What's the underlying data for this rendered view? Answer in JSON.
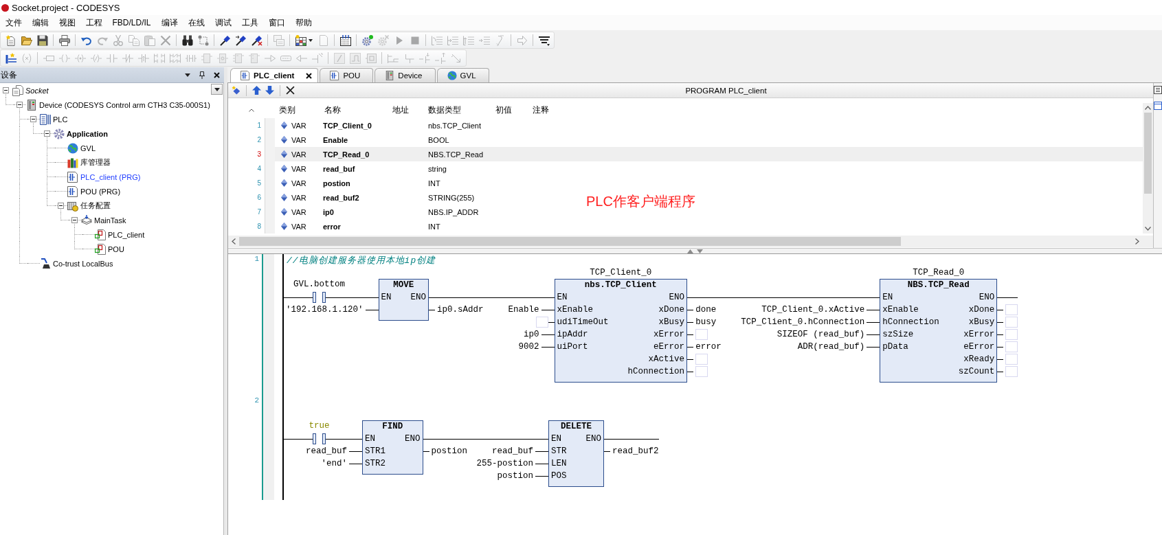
{
  "window": {
    "title": "Socket.project - CODESYS"
  },
  "menu": [
    "文件",
    "编辑",
    "视图",
    "工程",
    "FBD/LD/IL",
    "编译",
    "在线",
    "调试",
    "工具",
    "窗口",
    "帮助"
  ],
  "toolbars": [
    {
      "groups": [
        [
          {
            "kind": "new",
            "disabled": false
          },
          {
            "kind": "open",
            "disabled": false
          },
          {
            "kind": "save",
            "disabled": false
          }
        ],
        [
          {
            "kind": "print",
            "disabled": false
          }
        ],
        [
          {
            "kind": "undo",
            "disabled": false
          },
          {
            "kind": "redo",
            "disabled": true
          },
          {
            "kind": "cut",
            "disabled": true
          },
          {
            "kind": "copy",
            "disabled": true
          },
          {
            "kind": "paste",
            "disabled": true
          },
          {
            "kind": "delete",
            "disabled": true
          }
        ],
        [
          {
            "kind": "find",
            "disabled": false
          },
          {
            "kind": "replace",
            "disabled": false
          }
        ],
        [
          {
            "kind": "marker",
            "disabled": false
          },
          {
            "kind": "marker-next",
            "disabled": false
          },
          {
            "kind": "marker-clear",
            "disabled": false
          }
        ],
        [
          {
            "kind": "windows",
            "disabled": true
          }
        ],
        [
          {
            "kind": "table",
            "disabled": false,
            "menu": true
          },
          {
            "kind": "document",
            "disabled": true
          }
        ],
        [
          {
            "kind": "build",
            "disabled": false
          }
        ],
        [
          {
            "kind": "login",
            "disabled": false
          },
          {
            "kind": "logout",
            "disabled": true
          },
          {
            "kind": "play",
            "disabled": true
          },
          {
            "kind": "stop",
            "disabled": true
          }
        ],
        [
          {
            "kind": "step-over",
            "disabled": true
          },
          {
            "kind": "step-into",
            "disabled": true
          },
          {
            "kind": "step-out",
            "disabled": true
          },
          {
            "kind": "step-cursor",
            "disabled": true
          },
          {
            "kind": "step-next",
            "disabled": true
          }
        ],
        [
          {
            "kind": "forward",
            "disabled": true
          }
        ],
        [
          {
            "kind": "options",
            "disabled": false
          }
        ]
      ]
    },
    {
      "groups": [
        [
          {
            "kind": "network",
            "disabled": false
          },
          {
            "kind": "parens",
            "disabled": true
          }
        ],
        [
          {
            "kind": "variable",
            "disabled": true
          },
          {
            "kind": "coil",
            "disabled": true
          },
          {
            "kind": "coil-set",
            "disabled": true
          },
          {
            "kind": "coil-reset",
            "disabled": true
          },
          {
            "kind": "contact",
            "disabled": true
          },
          {
            "kind": "contact-neg",
            "disabled": true
          },
          {
            "kind": "contact-edge",
            "disabled": true
          },
          {
            "kind": "contacts-parallel",
            "disabled": true
          },
          {
            "kind": "contacts-neg-parallel",
            "disabled": true
          },
          {
            "kind": "contacts-series",
            "disabled": true
          },
          {
            "kind": "block",
            "disabled": true
          },
          {
            "kind": "block-ring",
            "disabled": true
          },
          {
            "kind": "block-pins",
            "disabled": true
          },
          {
            "kind": "block-stub",
            "disabled": true
          },
          {
            "kind": "jump",
            "disabled": true
          },
          {
            "kind": "label",
            "disabled": true
          },
          {
            "kind": "return",
            "disabled": true
          },
          {
            "kind": "branch-start",
            "disabled": true
          }
        ],
        [
          {
            "kind": "negate",
            "disabled": true
          },
          {
            "kind": "edge",
            "disabled": true
          },
          {
            "kind": "set",
            "disabled": true
          }
        ],
        [
          {
            "kind": "branch",
            "disabled": true
          },
          {
            "kind": "branch-end",
            "disabled": true
          },
          {
            "kind": "branch-down",
            "disabled": true
          },
          {
            "kind": "branch-up",
            "disabled": true
          },
          {
            "kind": "branch-diag",
            "disabled": true
          }
        ]
      ]
    }
  ],
  "device_tree": {
    "header": "设备",
    "items": [
      {
        "label": "Socket",
        "kind": "project",
        "expanded": true,
        "active": false,
        "highlighted": false,
        "children": [
          {
            "label": "Device (CODESYS Control arm CTH3 C35-000S1)",
            "kind": "device",
            "expanded": true,
            "active": false,
            "highlighted": false,
            "children": [
              {
                "label": "PLC",
                "kind": "plc",
                "expanded": true,
                "active": false,
                "highlighted": false,
                "children": [
                  {
                    "label": "Application",
                    "kind": "application",
                    "expanded": true,
                    "active": true,
                    "highlighted": false,
                    "children": [
                      {
                        "label": "GVL",
                        "kind": "gvl",
                        "active": false,
                        "highlighted": false
                      },
                      {
                        "label": "库管理器",
                        "kind": "library",
                        "active": false,
                        "highlighted": false
                      },
                      {
                        "label": "PLC_client (PRG)",
                        "kind": "program",
                        "active": false,
                        "highlighted": true
                      },
                      {
                        "label": "POU (PRG)",
                        "kind": "program",
                        "active": false,
                        "highlighted": false
                      },
                      {
                        "label": "任务配置",
                        "kind": "tasks",
                        "expanded": true,
                        "active": false,
                        "highlighted": false,
                        "children": [
                          {
                            "label": "MainTask",
                            "kind": "task",
                            "expanded": true,
                            "active": false,
                            "highlighted": false,
                            "children": [
                              {
                                "label": "PLC_client",
                                "kind": "call",
                                "active": false,
                                "highlighted": false
                              },
                              {
                                "label": "POU",
                                "kind": "call",
                                "active": false,
                                "highlighted": false
                              }
                            ]
                          }
                        ]
                      }
                    ]
                  }
                ]
              },
              {
                "label": "Co-trust LocalBus",
                "kind": "bus",
                "active": false,
                "highlighted": false
              }
            ]
          }
        ]
      }
    ]
  },
  "tabs": [
    {
      "label": "PLC_client",
      "kind": "program",
      "selected": true
    },
    {
      "label": "POU",
      "kind": "program",
      "selected": false
    },
    {
      "label": "Device",
      "kind": "device",
      "selected": false
    },
    {
      "label": "GVL",
      "kind": "gvl",
      "selected": false
    }
  ],
  "declaration": {
    "title": "PROGRAM PLC_client",
    "columns": [
      "类别",
      "名称",
      "地址",
      "数据类型",
      "初值",
      "注释"
    ],
    "rows": [
      {
        "line": "1",
        "class": "VAR",
        "name": "TCP_Client_0",
        "type": "nbs.TCP_Client",
        "selected": false
      },
      {
        "line": "2",
        "class": "VAR",
        "name": "Enable",
        "type": "BOOL",
        "selected": false
      },
      {
        "line": "3",
        "class": "VAR",
        "name": "TCP_Read_0",
        "type": "NBS.TCP_Read",
        "selected": true
      },
      {
        "line": "4",
        "class": "VAR",
        "name": "read_buf",
        "type": "string",
        "selected": false
      },
      {
        "line": "5",
        "class": "VAR",
        "name": "postion",
        "type": "INT",
        "selected": false
      },
      {
        "line": "6",
        "class": "VAR",
        "name": "read_buf2",
        "type": "STRING(255)",
        "selected": false
      },
      {
        "line": "7",
        "class": "VAR",
        "name": "ip0",
        "type": "NBS.IP_ADDR",
        "selected": false
      },
      {
        "line": "8",
        "class": "VAR",
        "name": "error",
        "type": "INT",
        "selected": false
      }
    ]
  },
  "annotation": "PLC作客户端程序",
  "ladder": {
    "networks": [
      {
        "number": "1",
        "comment": "//电脑创建服务器使用本地ip创建",
        "contact": {
          "variable": "GVL.bottom",
          "constant": false
        },
        "blocks": [
          {
            "type": "MOVE",
            "en": "EN",
            "eno": "ENO",
            "inputs": [
              {
                "value": "'192.168.1.120'"
              }
            ],
            "outputs": [
              {
                "value": "ip0.sAddr"
              }
            ]
          },
          {
            "instance": "TCP_Client_0",
            "type": "nbs.TCP_Client",
            "en": "EN",
            "eno": "ENO",
            "inputs": [
              {
                "pin": "xEnable",
                "value": "Enable"
              },
              {
                "pin": "udiTimeOut"
              },
              {
                "pin": "ipAddr",
                "value": "ip0"
              },
              {
                "pin": "uiPort",
                "value": "9002"
              }
            ],
            "outputs": [
              {
                "pin": "xDone",
                "value": "done"
              },
              {
                "pin": "xBusy",
                "value": "busy"
              },
              {
                "pin": "xError"
              },
              {
                "pin": "eError",
                "value": "error"
              },
              {
                "pin": "xActive"
              },
              {
                "pin": "hConnection"
              }
            ]
          },
          {
            "instance": "TCP_Read_0",
            "type": "NBS.TCP_Read",
            "en": "EN",
            "eno": "ENO",
            "inputs": [
              {
                "pin": "xEnable",
                "value": "TCP_Client_0.xActive"
              },
              {
                "pin": "hConnection",
                "value": "TCP_Client_0.hConnection"
              },
              {
                "pin": "szSize",
                "value": "SIZEOF (read_buf)"
              },
              {
                "pin": "pData",
                "value": "ADR(read_buf)"
              }
            ],
            "outputs": [
              {
                "pin": "xDone"
              },
              {
                "pin": "xBusy"
              },
              {
                "pin": "xError"
              },
              {
                "pin": "eError"
              },
              {
                "pin": "xReady"
              },
              {
                "pin": "szCount"
              }
            ]
          }
        ]
      },
      {
        "number": "2",
        "contact": {
          "variable": "true",
          "constant": true
        },
        "blocks": [
          {
            "type": "FIND",
            "en": "EN",
            "eno": "ENO",
            "inputs": [
              {
                "pin": "STR1",
                "value": "read_buf"
              },
              {
                "pin": "STR2",
                "value": "'end'"
              }
            ],
            "outputs": [
              {
                "value": "postion"
              }
            ]
          },
          {
            "type": "DELETE",
            "en": "EN",
            "eno": "ENO",
            "inputs": [
              {
                "pin": "STR",
                "value": "read_buf"
              },
              {
                "pin": "LEN",
                "value": "255-postion"
              },
              {
                "pin": "POS",
                "value": "postion"
              }
            ],
            "outputs": [
              {
                "value": "read_buf2"
              }
            ]
          }
        ]
      }
    ]
  }
}
